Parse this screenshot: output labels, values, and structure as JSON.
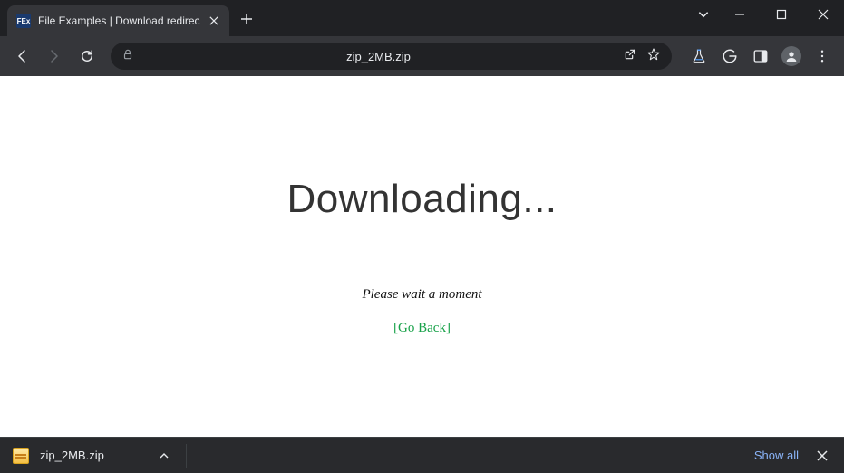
{
  "tab": {
    "favicon_text": "FEx",
    "title": "File Examples | Download redirec"
  },
  "omnibox": {
    "url_display": "zip_2MB.zip"
  },
  "page": {
    "heading": "Downloading...",
    "subtitle": "Please wait a moment",
    "go_back": "[Go Back]"
  },
  "download_bar": {
    "filename": "zip_2MB.zip",
    "show_all": "Show all"
  }
}
